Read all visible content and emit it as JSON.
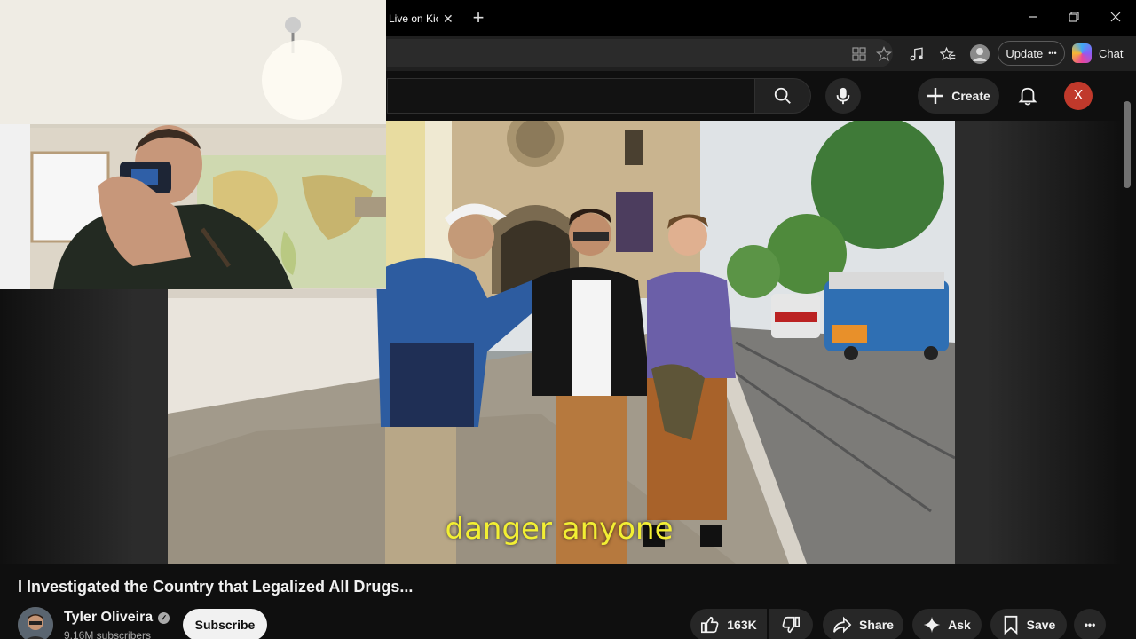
{
  "browser": {
    "tab_title": "Live on Kick",
    "tab_close": "✕",
    "new_tab": "+",
    "update_label": "Update",
    "update_more": "•••",
    "chat_label": "Chat"
  },
  "youtube": {
    "create_label": "Create",
    "avatar_letter": "X"
  },
  "video": {
    "subtitle": "danger anyone",
    "title": "I Investigated the Country that Legalized All Drugs..."
  },
  "channel": {
    "name": "Tyler Oliveira",
    "subscribers": "9.16M subscribers",
    "verified_mark": "✓",
    "subscribe_label": "Subscribe"
  },
  "actions": {
    "like_count": "163K",
    "share_label": "Share",
    "ask_label": "Ask",
    "save_label": "Save",
    "more_label": "•••"
  },
  "colors": {
    "accent_avatar": "#c0392b",
    "subtitle": "#f2ef33",
    "background": "#0f0f0f"
  }
}
